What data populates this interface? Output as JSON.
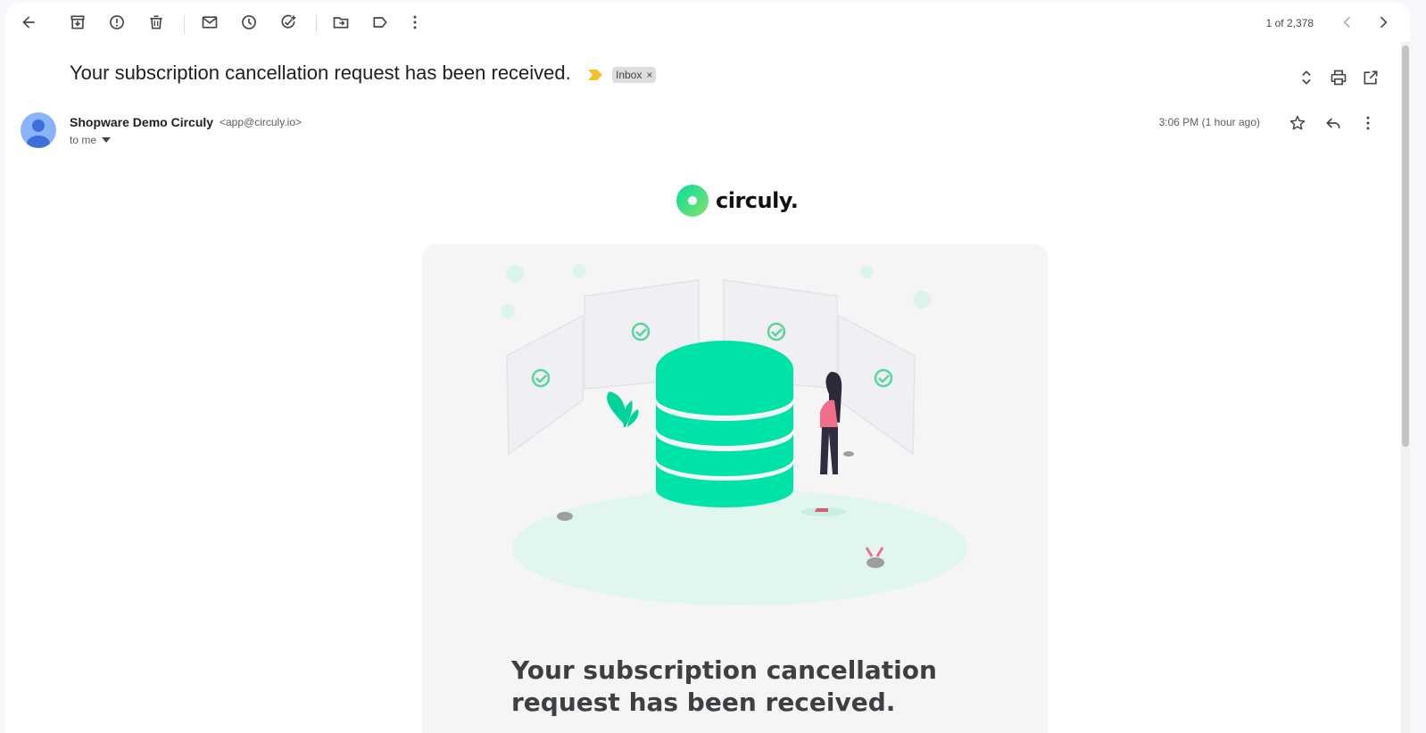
{
  "toolbar": {
    "icons": [
      "back-arrow-icon",
      "archive-icon",
      "report-spam-icon",
      "delete-icon",
      "mark-unread-icon",
      "snooze-icon",
      "add-task-icon",
      "move-to-icon",
      "label-icon",
      "more-vert-icon"
    ],
    "pager": "1 of 2,378"
  },
  "email": {
    "subject": "Your subscription cancellation request has been received.",
    "label_chip": "Inbox",
    "label_chip_close": "×",
    "sender_name": "Shopware Demo Circuly",
    "sender_email": "<app@circuly.io>",
    "recipient": "to me",
    "timestamp": "3:06 PM (1 hour ago)"
  },
  "body": {
    "logo_text": "circuly.",
    "headline": "Your subscription cancellation request has been received."
  },
  "colors": {
    "accent_green": "#00e3a8",
    "importance": "#f6c026",
    "avatar": "#8ab4f8"
  }
}
